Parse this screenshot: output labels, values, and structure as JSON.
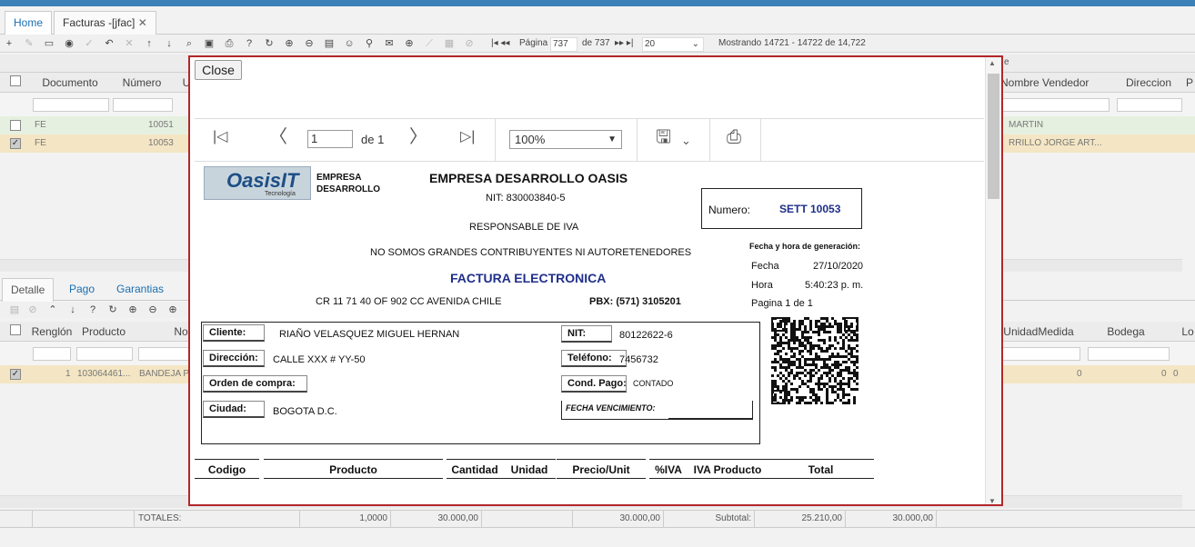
{
  "tabs": [
    {
      "label": "Home"
    },
    {
      "label": "Facturas -[jfac]"
    }
  ],
  "pager": {
    "page_label": "Página",
    "page": "737",
    "of": "de 737",
    "page_size": "20",
    "showing": "Mostrando 14721 - 14722 de 14,722"
  },
  "grid": {
    "headers": [
      "Documento",
      "Número",
      "U"
    ],
    "right_headers": [
      "Nombre Vendedor",
      "Direccion",
      "P"
    ],
    "right_partial": "e",
    "rows": [
      {
        "documento": "FE",
        "numero": "10051",
        "vendedor": "MARTIN",
        "checked": false
      },
      {
        "documento": "FE",
        "numero": "10053",
        "vendedor": "RRILLO JORGE ART...",
        "checked": true
      }
    ]
  },
  "subtabs": [
    {
      "label": "Detalle"
    },
    {
      "label": "Pago"
    },
    {
      "label": "Garantias"
    }
  ],
  "detail": {
    "headers": [
      "Renglón",
      "Producto",
      "No"
    ],
    "right_headers": [
      "UnidadMedida",
      "Bodega",
      "Lo"
    ],
    "row": {
      "renglon": "1",
      "producto": "103064461...",
      "nombre": "BANDEJA P",
      "unidad": "0",
      "bodega": "0",
      "lote": "0"
    }
  },
  "footer": {
    "totales": "TOTALES:",
    "qty": "1,0000",
    "v1": "30.000,00",
    "v2": "30.000,00",
    "subtotal_label": "Subtotal:",
    "subtotal": "25.210,00",
    "total": "30.000,00"
  },
  "modal": {
    "close": "Close",
    "viewer": {
      "page": "1",
      "of": "de 1",
      "zoom": "100%"
    },
    "invoice": {
      "logo_text": "OasisIT",
      "logo_sub": "Tecnología",
      "company_short": "EMPRESA DESARROLLO",
      "company": "EMPRESA DESARROLLO OASIS",
      "nit": "NIT: 830003840-5",
      "iva": "RESPONSABLE DE IVA",
      "contrib": "NO SOMOS GRANDES CONTRIBUYENTES NI AUTORETENEDORES",
      "title": "FACTURA ELECTRONICA",
      "address": "CR 11 71 40 OF 902 CC AVENIDA CHILE",
      "pbx": "PBX: (571) 3105201",
      "numero_label": "Numero:",
      "numero": "SETT 10053",
      "fecha_title": "Fecha y hora de generación:",
      "fecha_label": "Fecha",
      "fecha": "27/10/2020",
      "hora_label": "Hora",
      "hora": "5:40:23 p. m.",
      "pagina": "Pagina 1 de 1",
      "cliente_label": "Cliente:",
      "cliente": "RIAÑO  VELASQUEZ  MIGUEL  HERNAN",
      "nit_label": "NIT:",
      "nit_cliente": "80122622-6",
      "direccion_label": "Dirección:",
      "direccion": "CALLE XXX # YY-50",
      "telefono_label": "Teléfono:",
      "telefono": "7456732",
      "orden_label": "Orden de compra:",
      "cond_label": "Cond. Pago:",
      "cond": "CONTADO",
      "ciudad_label": "Ciudad:",
      "ciudad": "BOGOTA D.C.",
      "venc_label": "FECHA VENCIMIENTO:",
      "columns": [
        "Codigo",
        "Producto",
        "Cantidad",
        "Unidad",
        "Precio/Unit",
        "%IVA",
        "IVA Producto",
        "Total"
      ]
    }
  }
}
